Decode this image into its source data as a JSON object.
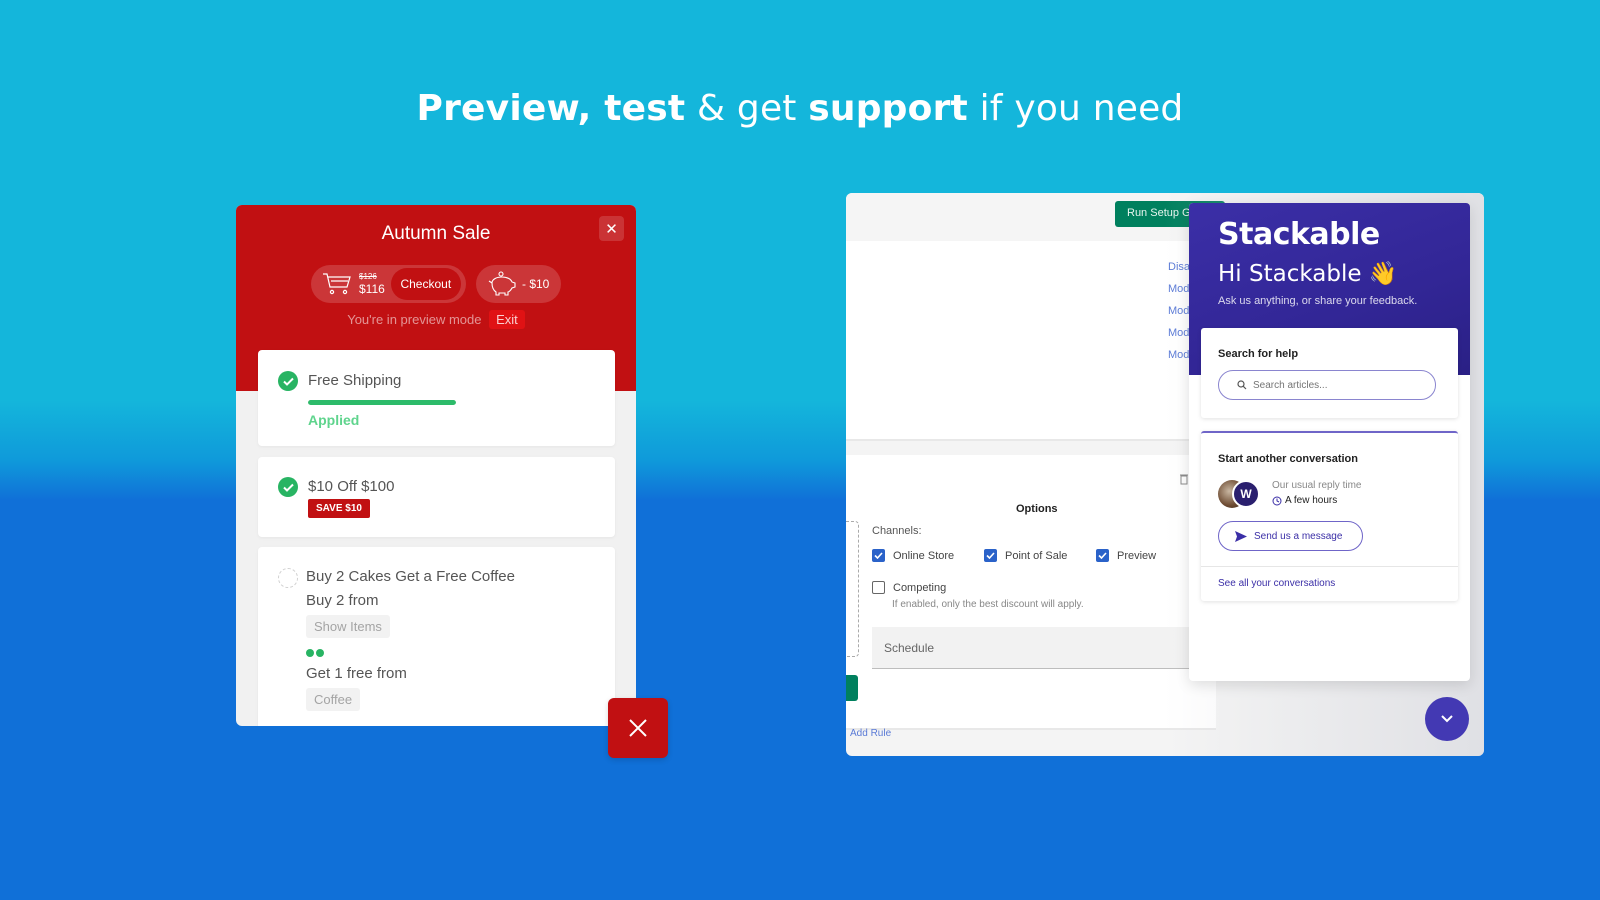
{
  "headline": {
    "part1_bold": "Preview, test",
    "part2": " & get ",
    "part3_bold": "support",
    "part4": " if you need"
  },
  "sale_widget": {
    "title": "Autumn Sale",
    "close_icon": "close-icon",
    "cart": {
      "icon": "cart-icon",
      "old_price": "$126",
      "new_price": "$116",
      "checkout_label": "Checkout"
    },
    "savings": {
      "icon": "piggy-bank-icon",
      "amount": "- $10"
    },
    "preview_notice": "You're in preview mode",
    "exit_label": "Exit",
    "offers": [
      {
        "title": "Free Shipping",
        "status": "complete",
        "progress_percent": 100,
        "status_text": "Applied"
      },
      {
        "title": "$10 Off $100",
        "status": "complete",
        "badge": "SAVE $10"
      },
      {
        "title": "Buy 2 Cakes Get a Free Coffee",
        "status": "pending",
        "buy_label": "Buy 2 from",
        "buy_chip": "Show Items",
        "progress_dots": 2,
        "get_label": "Get 1 free from",
        "get_chip": "Coffee"
      }
    ],
    "fab_icon": "close-icon"
  },
  "admin": {
    "run_setup_label": "Run Setup Gui",
    "links": [
      "Disab",
      "Modi",
      "Modi",
      "Modi",
      "Modi"
    ],
    "options_title": "Options",
    "channels_label": "Channels:",
    "channels": [
      {
        "label": "Online Store",
        "checked": true
      },
      {
        "label": "Point of Sale",
        "checked": true
      },
      {
        "label": "Preview",
        "checked": true
      }
    ],
    "competing": {
      "label": "Competing",
      "checked": false,
      "hint": "If enabled, only the best discount will apply."
    },
    "schedule_label": "Schedule",
    "add_rule_label": "Add Rule"
  },
  "chat": {
    "brand": "Stackable",
    "greeting": "Hi Stackable 👋",
    "subtitle": "Ask us anything, or share your feedback.",
    "search": {
      "heading": "Search for help",
      "placeholder": "Search articles..."
    },
    "conversation": {
      "heading": "Start another conversation",
      "avatar_initial": "W",
      "reply_label": "Our usual reply time",
      "reply_time": "A few hours",
      "send_label": "Send us a message",
      "see_all_label": "See all your conversations"
    },
    "fab_icon": "chevron-down-icon",
    "accent": "#3b2fa7"
  },
  "colors": {
    "sale_red": "#c11012",
    "success_green": "#28b463",
    "admin_green": "#00805e",
    "bg_top": "#14b6db",
    "bg_bottom": "#1070d8"
  }
}
